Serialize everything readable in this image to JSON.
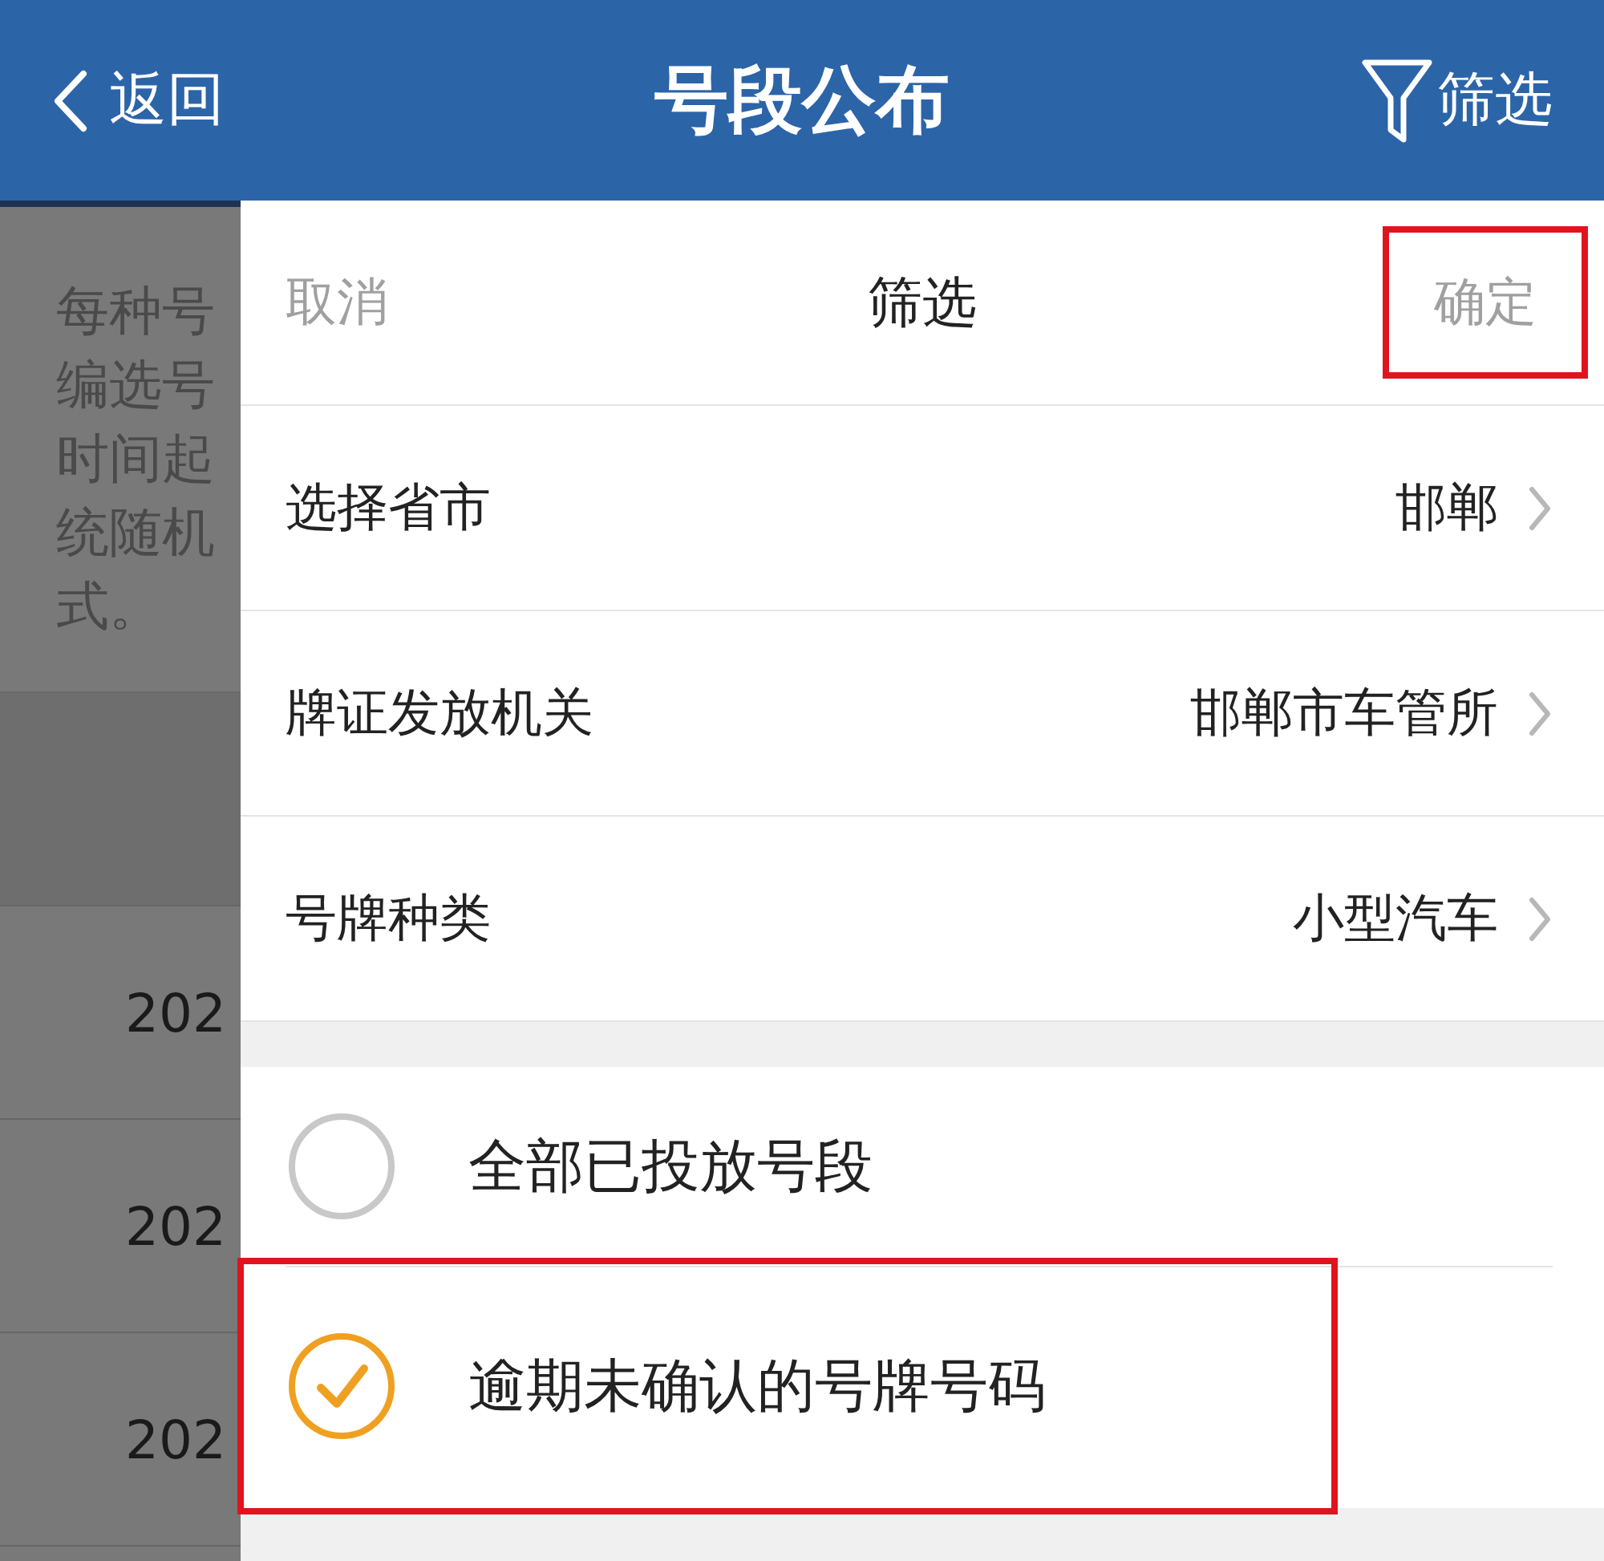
{
  "header": {
    "back": "返回",
    "title": "号段公布",
    "filter": "筛选"
  },
  "background": {
    "intro_lines": [
      "每种号",
      "编选号",
      "时间起",
      "统随机",
      "式。"
    ],
    "rows": [
      "202",
      "202",
      "202"
    ]
  },
  "filter_panel": {
    "cancel": "取消",
    "title": "筛选",
    "confirm": "确定",
    "fields": [
      {
        "label": "选择省市",
        "value": "邯郸"
      },
      {
        "label": "牌证发放机关",
        "value": "邯郸市车管所"
      },
      {
        "label": "号牌种类",
        "value": "小型汽车"
      }
    ],
    "options": [
      {
        "label": "全部已投放号段",
        "selected": false,
        "highlighted": false
      },
      {
        "label": "逾期未确认的号牌号码",
        "selected": true,
        "highlighted": true
      }
    ],
    "confirm_highlighted": true
  }
}
